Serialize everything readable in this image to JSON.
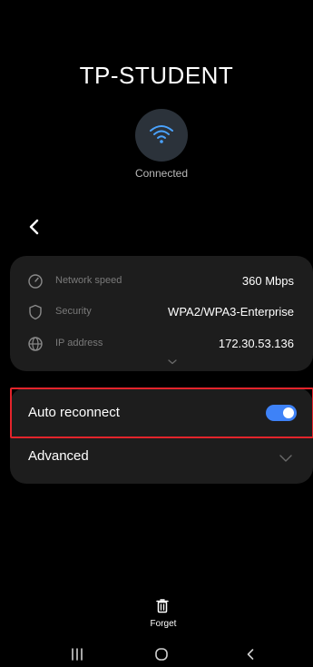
{
  "network": {
    "ssid": "TP-STUDENT",
    "status": "Connected"
  },
  "info": {
    "rows": [
      {
        "icon": "speed-gauge-icon",
        "label": "Network speed",
        "value": "360 Mbps"
      },
      {
        "icon": "shield-icon",
        "label": "Security",
        "value": "WPA2/WPA3-Enterprise"
      },
      {
        "icon": "globe-icon",
        "label": "IP address",
        "value": "172.30.53.136"
      }
    ]
  },
  "settings": {
    "auto_reconnect_label": "Auto reconnect",
    "auto_reconnect_enabled": true,
    "advanced_label": "Advanced"
  },
  "actions": {
    "forget_label": "Forget"
  },
  "colors": {
    "background": "#000000",
    "card": "#1d1d1d",
    "accent": "#3e82f7",
    "highlight_border": "#e3242b",
    "wifi_icon": "#4aa3ff"
  }
}
